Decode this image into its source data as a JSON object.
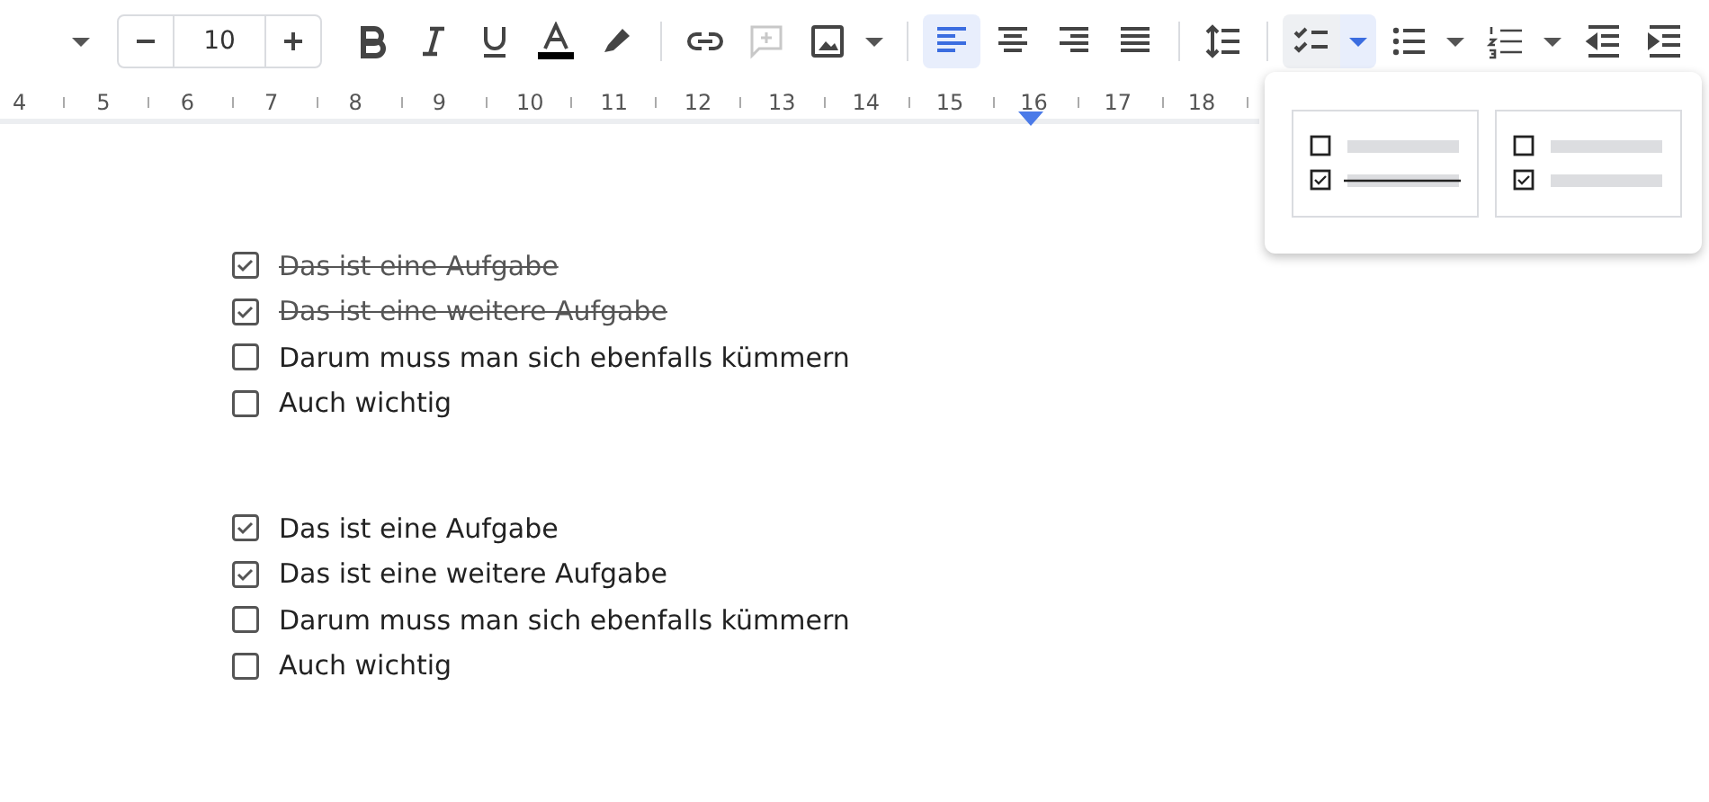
{
  "toolbar": {
    "font_size": "10",
    "buttons": [
      {
        "kind": "bold",
        "selected": false,
        "disabled": false
      },
      {
        "kind": "italic",
        "selected": false,
        "disabled": false
      },
      {
        "kind": "underline",
        "selected": false,
        "disabled": false
      },
      {
        "kind": "text-color",
        "selected": false,
        "disabled": false,
        "color": "#000000"
      },
      {
        "kind": "highlight",
        "selected": false,
        "disabled": false
      },
      {
        "kind": "sep"
      },
      {
        "kind": "link",
        "selected": false,
        "disabled": false
      },
      {
        "kind": "comment",
        "selected": false,
        "disabled": true
      },
      {
        "kind": "image",
        "selected": false,
        "disabled": false
      },
      {
        "kind": "sep"
      },
      {
        "kind": "align-left",
        "selected": true,
        "disabled": false
      },
      {
        "kind": "align-center",
        "selected": false,
        "disabled": false
      },
      {
        "kind": "align-right",
        "selected": false,
        "disabled": false
      },
      {
        "kind": "justify",
        "selected": false,
        "disabled": false
      },
      {
        "kind": "sep"
      },
      {
        "kind": "line-spacing",
        "selected": false,
        "disabled": false
      },
      {
        "kind": "sep"
      },
      {
        "kind": "checklist",
        "selected": true,
        "disabled": false
      },
      {
        "kind": "bullets",
        "selected": false,
        "disabled": false
      },
      {
        "kind": "numbered",
        "selected": false,
        "disabled": false
      },
      {
        "kind": "outdent",
        "selected": false,
        "disabled": false
      },
      {
        "kind": "indent",
        "selected": false,
        "disabled": false
      }
    ]
  },
  "ruler": {
    "numbers": [
      "4",
      "5",
      "6",
      "7",
      "8",
      "9",
      "10",
      "11",
      "12",
      "13",
      "14",
      "15",
      "16",
      "17",
      "18"
    ]
  },
  "lists": [
    {
      "strike_checked": true,
      "items": [
        {
          "text": "Das ist eine Aufgabe",
          "checked": true
        },
        {
          "text": "Das ist eine weitere Aufgabe",
          "checked": true
        },
        {
          "text": "Darum muss man sich ebenfalls kümmern",
          "checked": false
        },
        {
          "text": "Auch wichtig",
          "checked": false
        }
      ]
    },
    {
      "strike_checked": false,
      "items": [
        {
          "text": "Das ist eine Aufgabe",
          "checked": true
        },
        {
          "text": "Das ist eine weitere Aufgabe",
          "checked": true
        },
        {
          "text": "Darum muss man sich ebenfalls kümmern",
          "checked": false
        },
        {
          "text": "Auch wichtig",
          "checked": false
        }
      ]
    }
  ],
  "checklist_menu": {
    "options": [
      {
        "strike_checked": true
      },
      {
        "strike_checked": false
      }
    ]
  }
}
